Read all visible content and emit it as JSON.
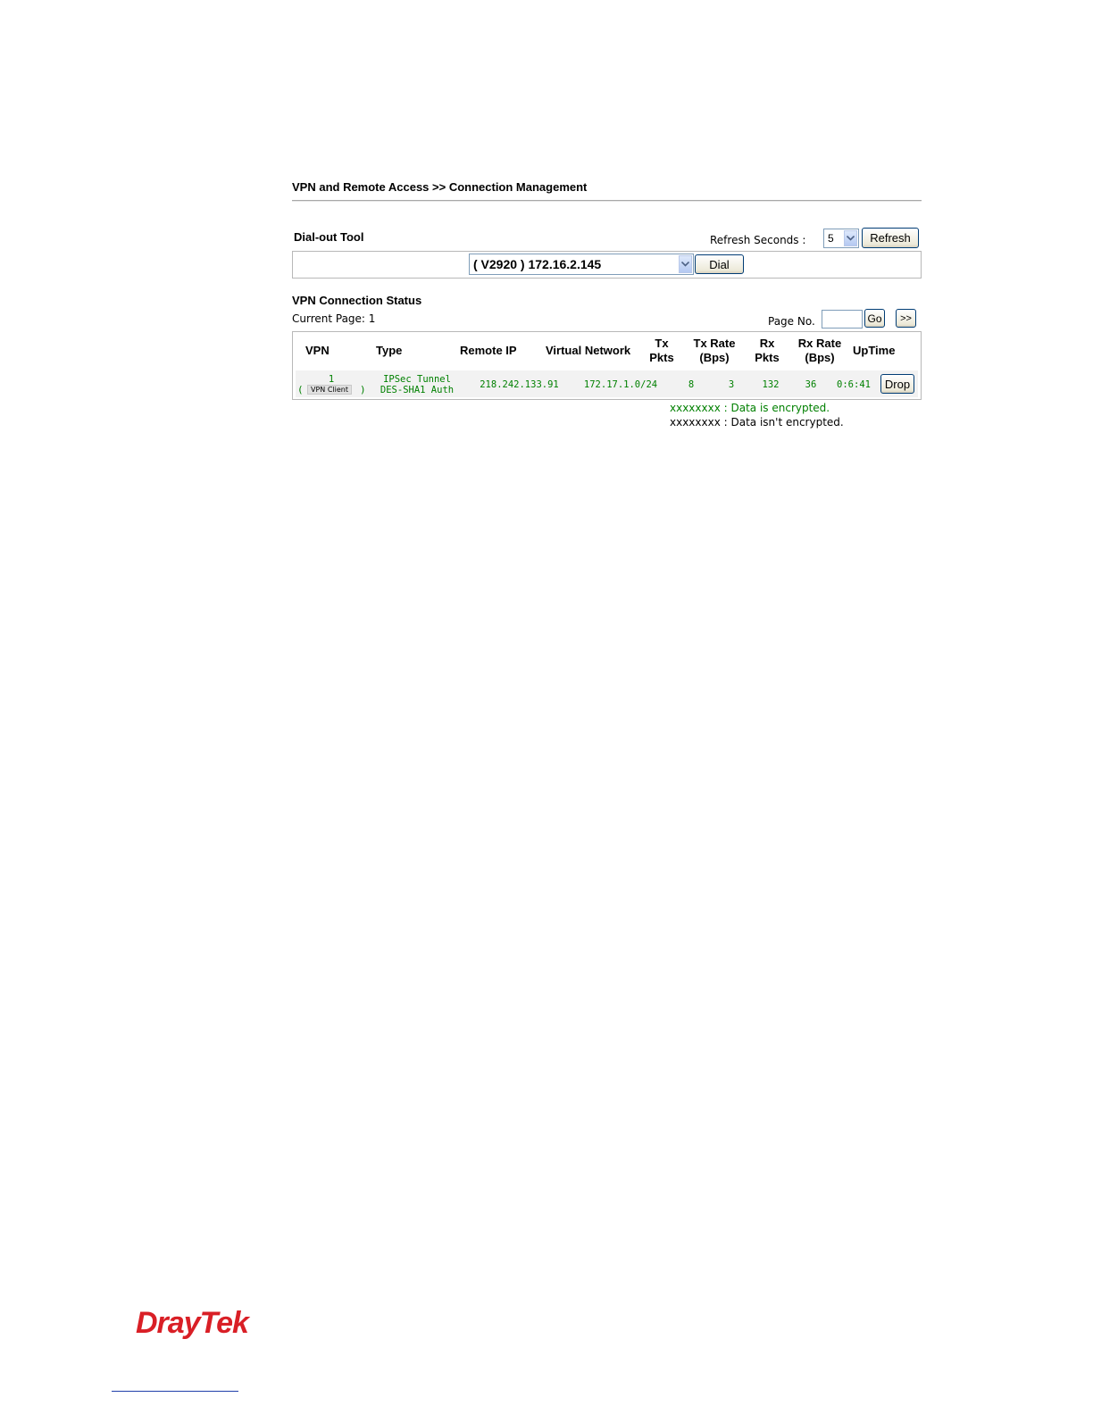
{
  "breadcrumb": "VPN and Remote Access >> Connection Management",
  "dialout": {
    "label": "Dial-out Tool",
    "refresh_label": "Refresh Seconds :",
    "refresh_value": "5",
    "refresh_button": "Refresh",
    "profile_value": "( V2920 ) 172.16.2.145",
    "dial_button": "Dial"
  },
  "status": {
    "label": "VPN Connection Status",
    "current_page": "Current Page: 1",
    "page_no_label": "Page No.",
    "page_no_value": "",
    "go_button": "Go",
    "next_button": ">>"
  },
  "table": {
    "headers": {
      "vpn": "VPN",
      "type": "Type",
      "remote_ip": "Remote IP",
      "virtual_network": "Virtual Network",
      "tx_pkts_1": "Tx",
      "tx_pkts_2": "Pkts",
      "tx_rate_1": "Tx Rate",
      "tx_rate_2": "(Bps)",
      "rx_pkts_1": "Rx",
      "rx_pkts_2": "Pkts",
      "rx_rate_1": "Rx Rate",
      "rx_rate_2": "(Bps)",
      "uptime": "UpTime"
    },
    "rows": [
      {
        "vpn": "1",
        "vpn_open": "(",
        "vpn_badge": "VPN Client",
        "vpn_close": ")",
        "type_1": "IPSec Tunnel",
        "type_2": "DES-SHA1 Auth",
        "remote_ip": "218.242.133.91",
        "virtual_network": "172.17.1.0/24",
        "tx_pkts": "8",
        "tx_rate": "3",
        "rx_pkts": "132",
        "rx_rate": "36",
        "uptime": "0:6:41",
        "drop_button": "Drop"
      }
    ]
  },
  "legend": {
    "encrypted": "xxxxxxxx : Data is encrypted.",
    "not_encrypted": "xxxxxxxx : Data isn't encrypted."
  },
  "footer": {
    "logo_text": "DrayTek"
  },
  "colors": {
    "encrypted_text": "#008000",
    "logo": "#d91f26"
  }
}
